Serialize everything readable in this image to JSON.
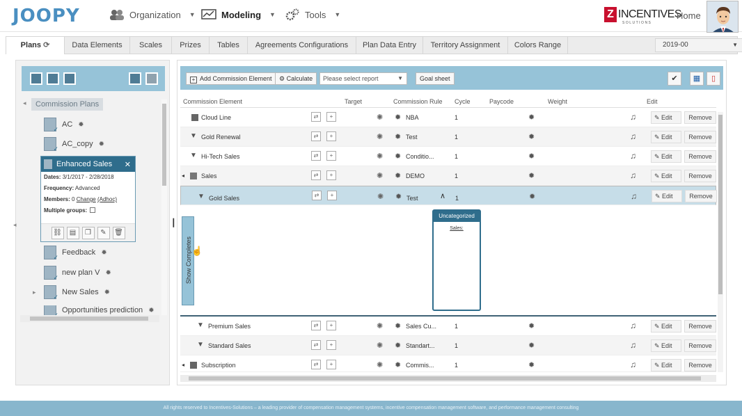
{
  "header": {
    "logo": "JOOPY",
    "nav": [
      {
        "label": "Organization",
        "icon": "people-icon"
      },
      {
        "label": "Modeling",
        "icon": "chart-icon"
      },
      {
        "label": "Tools",
        "icon": "gears-icon"
      }
    ],
    "brand": "INCENTIVES",
    "brand_sub": "SOLUTIONS",
    "home": "Home"
  },
  "tabs": [
    "Plans",
    "Data Elements",
    "Scales",
    "Prizes",
    "Tables",
    "Agreements Configurations",
    "Plan Data Entry",
    "Territory Assignment",
    "Colors Range"
  ],
  "year_select": "2019-00",
  "tree": {
    "root": "Commission Plans",
    "items": [
      "AC",
      "AC_copy",
      "Feedback",
      "new plan V",
      "New Sales",
      "Opportunities prediction"
    ]
  },
  "popup": {
    "title": "Enhanced Sales",
    "dates_label": "Dates:",
    "dates": "3/1/2017 - 2/28/2018",
    "freq_label": "Frequency:",
    "freq": "Advanced",
    "members_label": "Members:",
    "members_count": "0",
    "change": "Change",
    "adhoc": "(Adhoc)",
    "groups_label": "Multiple groups:"
  },
  "toolbar": {
    "add": "Add Commission Element",
    "calculate": "Calculate",
    "report_placeholder": "Please select report",
    "goal_sheet": "Goal sheet"
  },
  "columns": [
    "Commission Element",
    "Target",
    "Commission Rule",
    "Cycle",
    "Paycode",
    "Weight",
    "Edit"
  ],
  "rows": [
    {
      "name": "Cloud Line",
      "rule": "NBA",
      "cycle": "1"
    },
    {
      "name": "Gold Renewal",
      "rule": "Test",
      "cycle": "1"
    },
    {
      "name": "Hi-Tech Sales",
      "rule": "Conditio...",
      "cycle": "1"
    },
    {
      "name": "Sales",
      "rule": "DEMO",
      "cycle": "1"
    },
    {
      "name": "Gold Sales",
      "rule": "Test",
      "cycle": "1"
    },
    {
      "name": "Premium Sales",
      "rule": "Sales Cu...",
      "cycle": "1"
    },
    {
      "name": "Standard Sales",
      "rule": "Standart...",
      "cycle": "1"
    },
    {
      "name": "Subscription",
      "rule": "Commis...",
      "cycle": "1"
    }
  ],
  "edit_label": "Edit",
  "remove_label": "Remove",
  "detail": {
    "show_completes": "Show Completes",
    "category": "Uncategorized",
    "category_item": "Sales:"
  },
  "footer": "All rights reserved to Incentives-Solutions – a leading provider of compensation management systems, incentive compensation management software, and performance management consulting"
}
